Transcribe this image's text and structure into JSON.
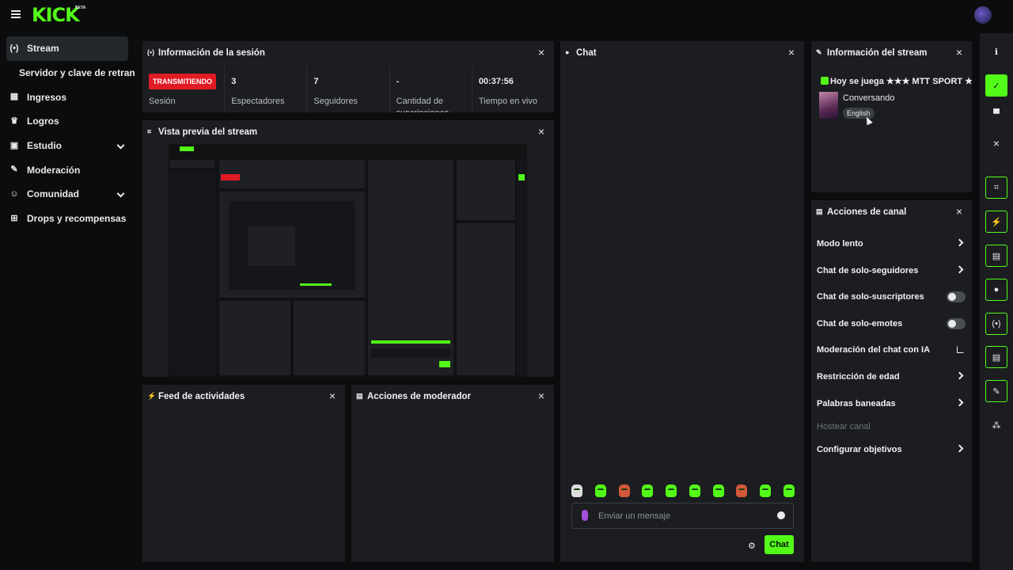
{
  "topbar": {
    "logo": "KICK",
    "logo_beta": "BETA"
  },
  "sidebar": {
    "items": [
      {
        "label": "Stream",
        "icon": "broadcast-icon"
      },
      {
        "label": "Servidor y clave de retransmisión"
      },
      {
        "label": "Ingresos",
        "icon": "chart-icon"
      },
      {
        "label": "Logros",
        "icon": "trophy-icon"
      },
      {
        "label": "Estudio",
        "icon": "studio-icon"
      },
      {
        "label": "Moderación",
        "icon": "wrench-icon"
      },
      {
        "label": "Comunidad",
        "icon": "users-icon"
      },
      {
        "label": "Drops y recompensas",
        "icon": "gift-icon"
      }
    ]
  },
  "session_panel": {
    "title": "Información de la sesión",
    "status_badge": "TRANSMITIENDO",
    "status_label": "Sesión",
    "stats": [
      {
        "value": "3",
        "label": "Espectadores"
      },
      {
        "value": "7",
        "label": "Seguidores"
      },
      {
        "value": "-",
        "label": "Cantidad de suscripciones"
      },
      {
        "value": "00:37:56",
        "label": "Tiempo en vivo"
      }
    ]
  },
  "preview_panel": {
    "title": "Vista previa del stream"
  },
  "activity_panel": {
    "title": "Feed de actividades"
  },
  "mod_actions_panel": {
    "title": "Acciones de moderador"
  },
  "chat_panel": {
    "title": "Chat",
    "input_placeholder": "Enviar un mensaje",
    "send_label": "Chat"
  },
  "stream_info_panel": {
    "title": "Información del stream",
    "stream_title": "Hoy se juega ★★★ MTT SPORT ★★★",
    "category": "Conversando",
    "language": "English"
  },
  "channel_actions_panel": {
    "title": "Acciones de canal",
    "actions": [
      {
        "label": "Modo lento",
        "control": "chevron"
      },
      {
        "label": "Chat de solo-seguidores",
        "control": "chevron"
      },
      {
        "label": "Chat de solo-suscriptores",
        "control": "toggle",
        "enabled": false
      },
      {
        "label": "Chat de solo-emotes",
        "control": "toggle",
        "enabled": false
      },
      {
        "label": "Moderación del chat con IA",
        "control": "external"
      },
      {
        "label": "Restricción de edad",
        "control": "chevron"
      },
      {
        "label": "Palabras baneadas",
        "control": "chevron"
      },
      {
        "label": "Hostear canal",
        "control": "none",
        "disabled": true
      },
      {
        "label": "Configurar objetivos",
        "control": "chevron"
      }
    ]
  },
  "colors": {
    "accent": "#53fc18",
    "live": "#e01b24",
    "panel": "#1b1d20",
    "background": "#0b0c0d"
  }
}
